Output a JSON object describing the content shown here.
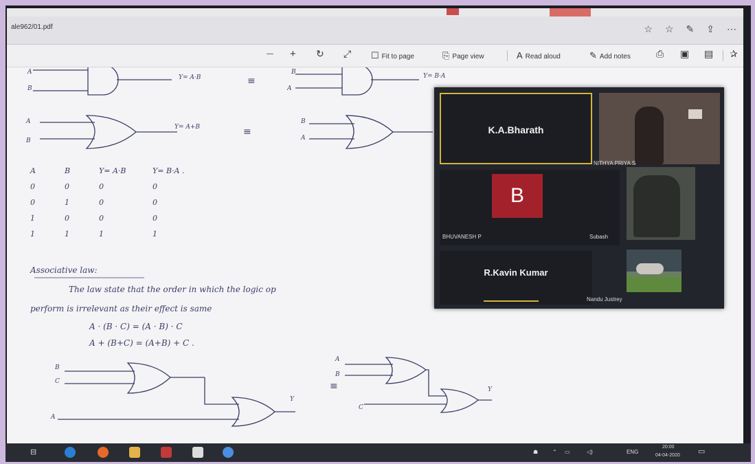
{
  "browser": {
    "url": "ale962/01.pdf",
    "icons": [
      "star-icon",
      "favorites-icon",
      "pen-icon",
      "share-icon",
      "more-icon"
    ]
  },
  "toolbar": {
    "zoom_out": "—",
    "zoom_in": "+",
    "rotate": "↻",
    "fullscreen": "⤢",
    "fit_to_page": "Fit to page",
    "page_view": "Page view",
    "read_aloud": "Read aloud",
    "add_notes": "Add notes",
    "read_aloud_icon": "A",
    "add_notes_icon": "✎"
  },
  "document": {
    "gate1_output": "Y= A·B",
    "gate1b_output": "Y= B·A",
    "gate2_output": "Y= A+B",
    "equiv": "≡",
    "gate_in_a": "A",
    "gate_in_b": "B",
    "truth_table": {
      "headers": [
        "A",
        "B",
        "Y= A·B",
        "Y= B·A ."
      ],
      "rows": [
        [
          "0",
          "0",
          "0",
          "0"
        ],
        [
          "0",
          "1",
          "0",
          "0"
        ],
        [
          "1",
          "0",
          "0",
          "0"
        ],
        [
          "1",
          "1",
          "1",
          "1"
        ]
      ]
    },
    "section_title": "Associative law:",
    "line1": "The law state that the order in which the logic op",
    "line2": "perform is irrelevant as their effect is same",
    "eq1": "A · (B · C)   = (A · B) · C",
    "eq2": "A + (B+C)   = (A+B) + C .",
    "circ_b": "B",
    "circ_c": "C",
    "circ_a": "A",
    "circ_y": "Y",
    "circ2_a": "A",
    "circ2_b": "B",
    "circ2_c": "C",
    "circ2_y": "Y"
  },
  "meeting": {
    "participants": [
      {
        "name": "K.A.Bharath",
        "active": true
      },
      {
        "name": "NITHYA PRIYA S"
      },
      {
        "name": "BHUVANESH P",
        "initial": "B"
      },
      {
        "name": "Subash"
      },
      {
        "name": "R.Kavin Kumar"
      },
      {
        "name": "Nandu Justrey"
      }
    ]
  },
  "taskbar": {
    "lang": "ENG",
    "time": "20:00",
    "date": "04-04-2020"
  },
  "colors": {
    "ink": "#3a3d66",
    "active_border": "#d4b43c",
    "avatar_bg": "#a3212b"
  }
}
